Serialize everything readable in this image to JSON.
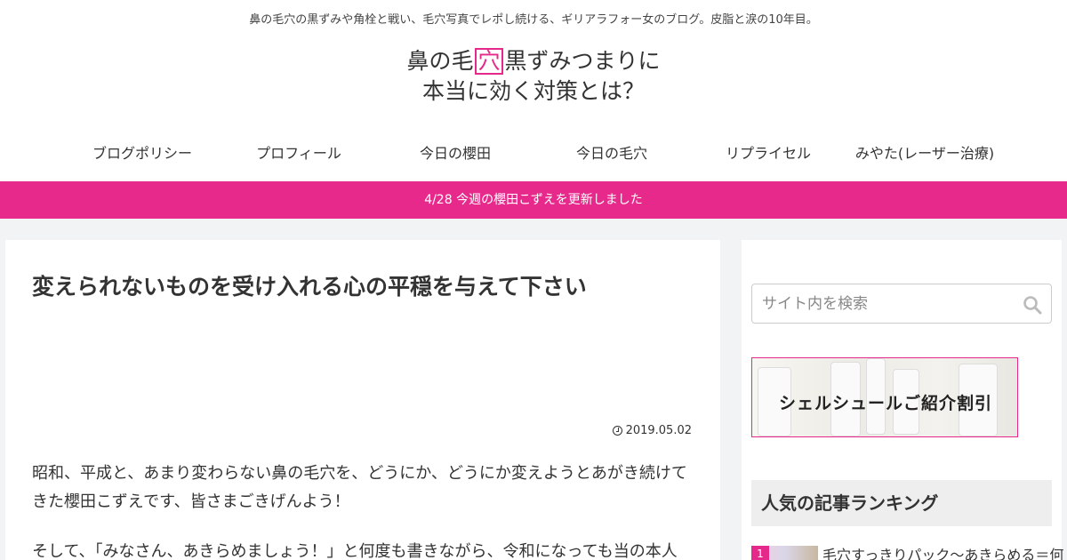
{
  "header": {
    "tagline": "鼻の毛穴の黒ずみや角栓と戦い、毛穴写真でレポし続ける、ギリアラフォー女のブログ。皮脂と涙の10年目。",
    "logo": {
      "line1_before": "鼻の毛",
      "line1_boxed": "穴",
      "line1_after": "黒ずみつまりに",
      "line2": "本当に効く対策とは？"
    }
  },
  "nav": {
    "items": [
      {
        "label": "ブログポリシー"
      },
      {
        "label": "プロフィール"
      },
      {
        "label": "今日の櫻田"
      },
      {
        "label": "今日の毛穴"
      },
      {
        "label": "リプライセル"
      },
      {
        "label": "みやた(レーザー治療)"
      }
    ]
  },
  "notice": {
    "text": "4/28 今週の櫻田こずえを更新しました"
  },
  "article": {
    "title": "変えられないものを受け入れる心の平穏を与えて下さい",
    "date": "2019.05.02",
    "paragraphs": [
      "昭和、平成と、あまり変わらない鼻の毛穴を、どうにか、どうにか変えようとあがき続けてきた櫻田こずえです、皆さまごきげんよう！",
      "そして、「みなさん、あきらめましょう！」と何度も書きながら、令和になっても当の本人"
    ]
  },
  "sidebar": {
    "search": {
      "placeholder": "サイト内を検索"
    },
    "banner": {
      "text": "シェルシュールご紹介割引"
    },
    "ranking": {
      "heading": "人気の記事ランキング",
      "items": [
        {
          "rank": "1",
          "title": "毛穴すっきりパック〜あきらめる＝何"
        }
      ]
    }
  },
  "colors": {
    "accent": "#e8298c"
  }
}
